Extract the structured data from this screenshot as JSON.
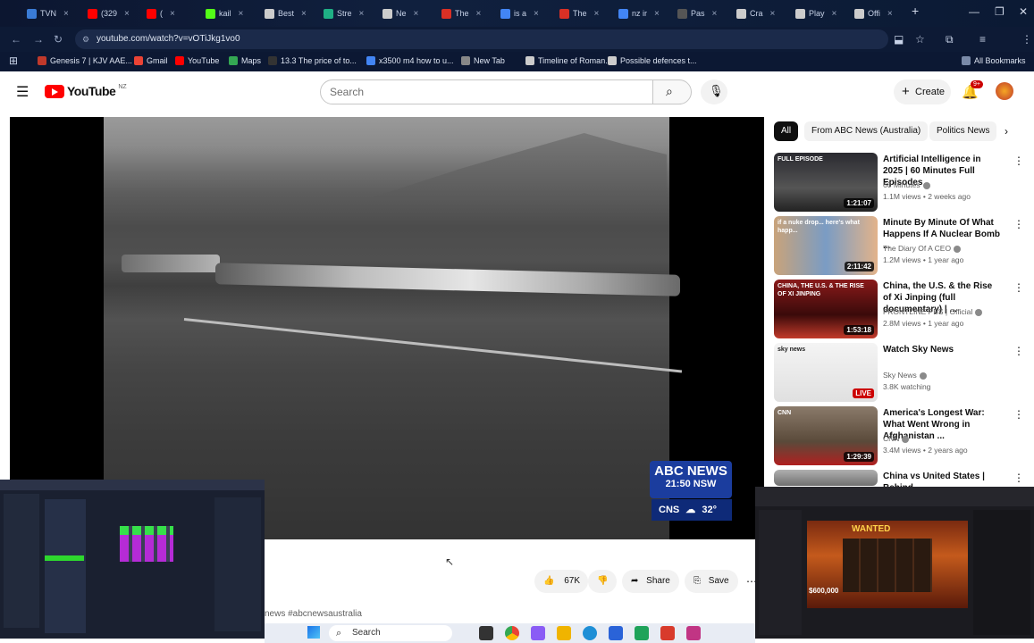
{
  "browser": {
    "tabs": [
      {
        "label": "TVN",
        "color": "#3a7bd5"
      },
      {
        "label": "(329",
        "color": "#ff0000"
      },
      {
        "label": "(",
        "color": "#ff0000"
      },
      {
        "label": "kail",
        "color": "#53fc18"
      },
      {
        "label": "Best",
        "color": "#cccccc"
      },
      {
        "label": "Stre",
        "color": "#1fb085"
      },
      {
        "label": "Ne",
        "color": "#cccccc"
      },
      {
        "label": "The",
        "color": "#d93025"
      },
      {
        "label": "is a",
        "color": "#4285f4"
      },
      {
        "label": "The",
        "color": "#d93025"
      },
      {
        "label": "nz ir",
        "color": "#4285f4"
      },
      {
        "label": "Pas",
        "color": "#555555"
      },
      {
        "label": "Cra",
        "color": "#cccccc"
      },
      {
        "label": "Play",
        "color": "#cccccc"
      },
      {
        "label": "Offi",
        "color": "#cccccc"
      }
    ],
    "url": "youtube.com/watch?v=vOTiJkg1vo0",
    "bookmarks": [
      {
        "label": "Genesis 7 | KJV AAE...",
        "color": "#c0392b"
      },
      {
        "label": "Gmail",
        "color": "#ea4335"
      },
      {
        "label": "YouTube",
        "color": "#ff0000"
      },
      {
        "label": "Maps",
        "color": "#34a853"
      },
      {
        "label": "13.3 The price of to...",
        "color": "#333333"
      },
      {
        "label": "x3500 m4 how to u...",
        "color": "#4285f4"
      },
      {
        "label": "New Tab",
        "color": "#888888"
      },
      {
        "label": "Timeline of Roman...",
        "color": "#cccccc"
      },
      {
        "label": "Possible defences t...",
        "color": "#cccccc"
      }
    ],
    "all_bookmarks": "All Bookmarks"
  },
  "youtube": {
    "logo_text": "YouTube",
    "region": "NZ",
    "search_placeholder": "Search",
    "create_label": "Create",
    "notif_count": "9+"
  },
  "player": {
    "news_brand": "ABC NEWS",
    "news_time": "21:50 NSW",
    "weather_city": "CNS",
    "weather_temp": "32°"
  },
  "actions": {
    "like_count": "67K",
    "share_label": "Share",
    "save_label": "Save",
    "hashtags": "news #abcnewsaustralia"
  },
  "sidebar": {
    "chips": [
      "All",
      "From ABC News (Australia)",
      "Politics News"
    ],
    "recommendations": [
      {
        "title": "Artificial Intelligence in 2025 | 60 Minutes Full Episodes",
        "channel": "60 Minutes",
        "meta": "1.1M views • 2 weeks ago",
        "duration": "1:21:07",
        "badge": "FULL EPISODE"
      },
      {
        "title": "Minute By Minute Of What Happens If A Nuclear Bomb ...",
        "channel": "The Diary Of A CEO",
        "meta": "1.2M views • 1 year ago",
        "duration": "2:11:42",
        "badge": "if a nuke drop... here's what happ..."
      },
      {
        "title": "China, the U.S. & the Rise of Xi Jinping (full documentary) | ...",
        "channel": "FRONTLINE PBS | Official",
        "meta": "2.8M views • 1 year ago",
        "duration": "1:53:18",
        "badge": "CHINA, THE U.S. & THE RISE OF XI JINPING"
      },
      {
        "title": "Watch Sky News",
        "channel": "Sky News",
        "meta": "3.8K watching",
        "duration": "LIVE",
        "badge": "sky news"
      },
      {
        "title": "America's Longest War: What Went Wrong in Afghanistan ...",
        "channel": "CNN",
        "meta": "3.4M views • 2 years ago",
        "duration": "1:29:39",
        "badge": "CNN"
      },
      {
        "title": "China vs United States | Behind",
        "channel": "",
        "meta": "",
        "duration": "",
        "badge": ""
      }
    ]
  },
  "taskbar": {
    "search_label": "Search"
  },
  "stream_overlay": {
    "banner": "WANTED",
    "amount": "$600,000"
  }
}
